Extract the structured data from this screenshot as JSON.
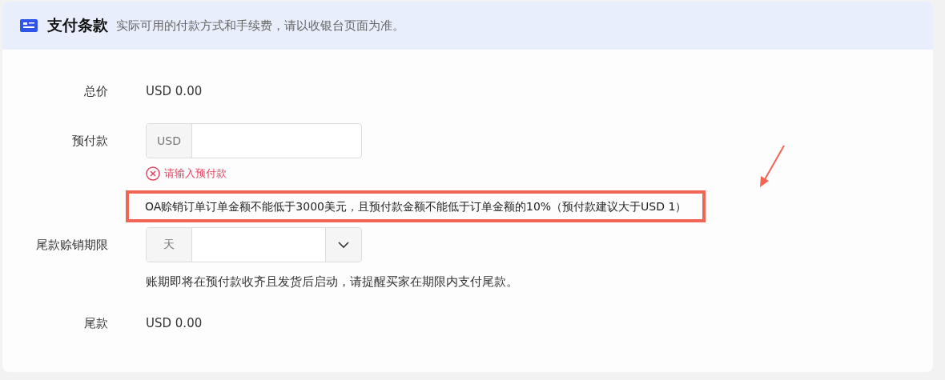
{
  "header": {
    "title": "支付条款",
    "subtitle": "实际可用的付款方式和手续费，请以收银台页面为准。"
  },
  "fields": [
    {
      "kind": "value",
      "label": "总价",
      "value": "USD 0.00"
    },
    {
      "kind": "input",
      "label": "预付款",
      "addon": "USD",
      "error": "请输入预付款",
      "note": "OA赊销订单订单金额不能低于3000美元，且预付款金额不能低于订单金额的10%（预付款建议大于USD 1）",
      "note_highlighted": true
    },
    {
      "kind": "select",
      "label": "尾款赊销期限",
      "addon": "天",
      "hint": "账期即将在预付款收齐且发货后启动，请提醒买家在期限内支付尾款。"
    },
    {
      "kind": "value",
      "label": "尾款",
      "value": "USD 0.00"
    }
  ]
}
